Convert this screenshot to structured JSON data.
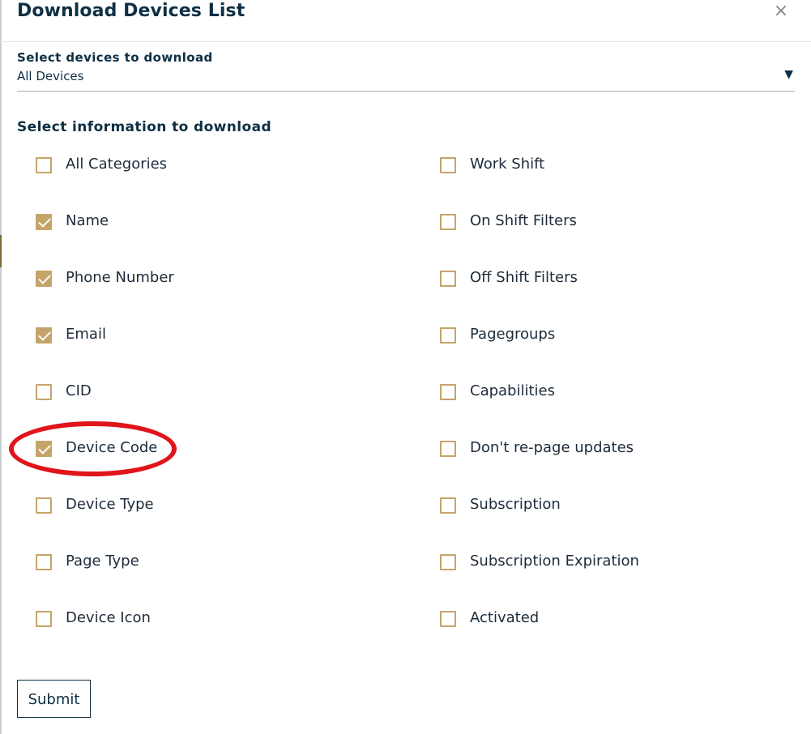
{
  "dialog": {
    "title": "Download Devices List",
    "close_icon": "close-icon",
    "close_glyph": "×"
  },
  "devices_select": {
    "label": "Select devices to download",
    "value": "All Devices",
    "arrow_glyph": "▼"
  },
  "info_section": {
    "label": "Select information to download",
    "left_options": [
      {
        "label": "All Categories",
        "checked": false
      },
      {
        "label": "Name",
        "checked": true
      },
      {
        "label": "Phone Number",
        "checked": true
      },
      {
        "label": "Email",
        "checked": true
      },
      {
        "label": "CID",
        "checked": false
      },
      {
        "label": "Device Code",
        "checked": true
      },
      {
        "label": "Device Type",
        "checked": false
      },
      {
        "label": "Page Type",
        "checked": false
      },
      {
        "label": "Device Icon",
        "checked": false
      }
    ],
    "right_options": [
      {
        "label": "Work Shift",
        "checked": false
      },
      {
        "label": "On Shift Filters",
        "checked": false
      },
      {
        "label": "Off Shift Filters",
        "checked": false
      },
      {
        "label": "Pagegroups",
        "checked": false
      },
      {
        "label": "Capabilities",
        "checked": false
      },
      {
        "label": "Don't re-page updates",
        "checked": false
      },
      {
        "label": "Subscription",
        "checked": false
      },
      {
        "label": "Subscription Expiration",
        "checked": false
      },
      {
        "label": "Activated",
        "checked": false
      }
    ]
  },
  "submit_label": "Submit",
  "colors": {
    "accent_gold": "#c5a46a",
    "title_navy": "#0e2f44",
    "highlight_red": "#e0141b"
  }
}
